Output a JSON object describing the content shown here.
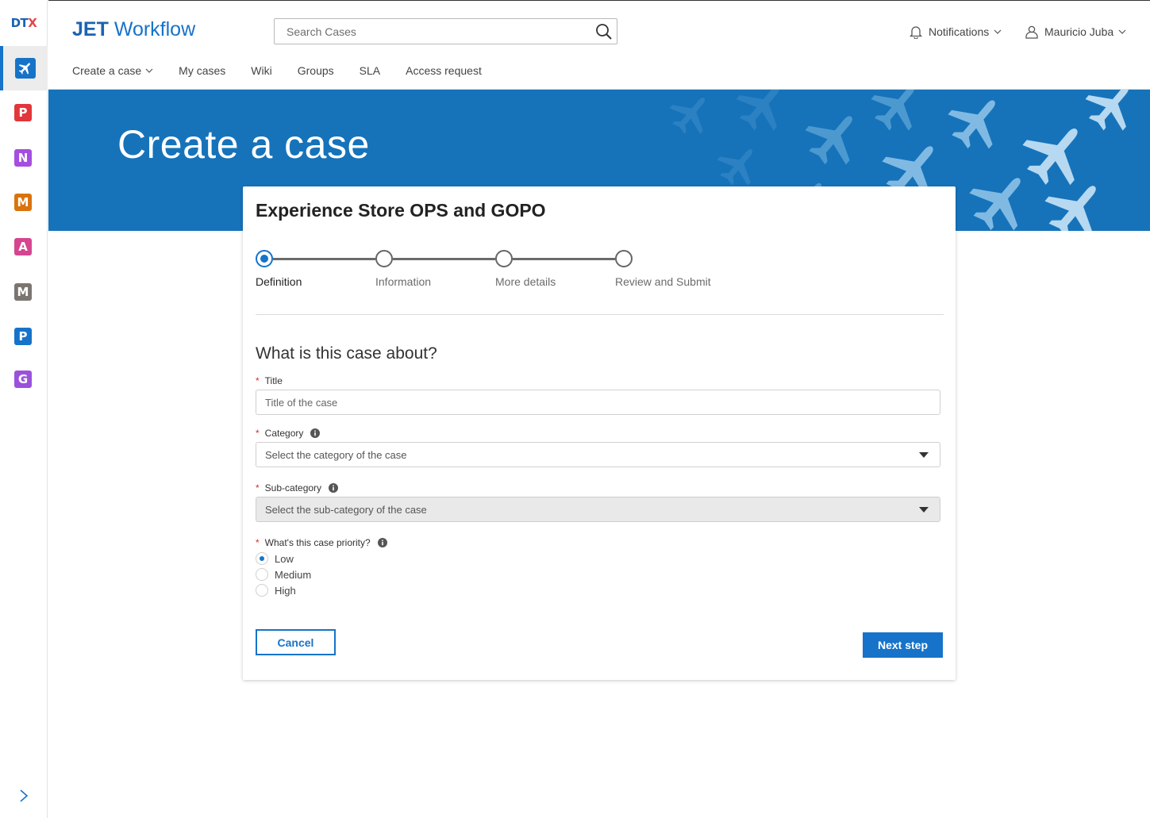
{
  "rail": {
    "logo_main": "DT",
    "logo_x": "X",
    "active_icon": "airplane-icon",
    "apps": [
      {
        "letter": "P",
        "color": "#e2363a"
      },
      {
        "letter": "N",
        "color": "#a54ee0"
      },
      {
        "letter": "M",
        "color": "#d9730d"
      },
      {
        "letter": "A",
        "color": "#d64590"
      },
      {
        "letter": "M",
        "color": "#7b7571"
      },
      {
        "letter": "P",
        "color": "#1673c9"
      },
      {
        "letter": "G",
        "color": "#9a52dc"
      }
    ],
    "expand_icon": "chevron-right-icon"
  },
  "header": {
    "brand_bold": "JET",
    "brand_light": "Workflow",
    "search_placeholder": "Search Cases",
    "search_icon": "search-icon",
    "notifications_label": "Notifications",
    "user_name": "Mauricio Juba",
    "nav": [
      {
        "label": "Create a case",
        "has_dropdown": true
      },
      {
        "label": "My cases"
      },
      {
        "label": "Wiki"
      },
      {
        "label": "Groups"
      },
      {
        "label": "SLA"
      },
      {
        "label": "Access request"
      }
    ]
  },
  "banner": {
    "title": "Create a case",
    "color": "#1673ba"
  },
  "card": {
    "title": "Experience Store OPS and GOPO",
    "steps": [
      {
        "label": "Definition",
        "active": true
      },
      {
        "label": "Information",
        "active": false
      },
      {
        "label": "More details",
        "active": false
      },
      {
        "label": "Review and Submit",
        "active": false
      }
    ],
    "section_heading": "What is this case about?",
    "title_field": {
      "label": "Title",
      "placeholder": "Title of the case",
      "value": ""
    },
    "category_field": {
      "label": "Category",
      "placeholder": "Select the category of the case"
    },
    "subcategory_field": {
      "label": "Sub-category",
      "placeholder": "Select the sub-category of the case",
      "disabled": true
    },
    "priority": {
      "label": "What's this case priority?",
      "options": [
        "Low",
        "Medium",
        "High"
      ],
      "selected": "Low"
    },
    "cancel_label": "Cancel",
    "next_label": "Next step"
  },
  "colors": {
    "accent": "#1673c9",
    "required": "#d0312d"
  }
}
